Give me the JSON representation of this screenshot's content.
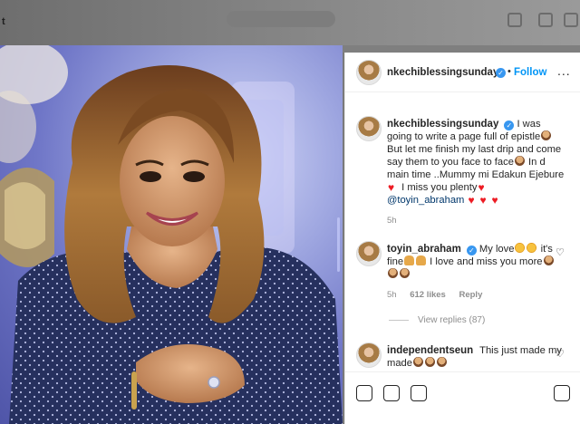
{
  "page_fragment": "t",
  "post": {
    "author": "nkechiblessingsunday",
    "follow_separator": "•",
    "follow_label": "Follow",
    "more_label": "...",
    "caption_part1": "I was going to write a page full of epistle",
    "caption_part2": " But let me finish my last drip and come say them to you face to face",
    "caption_part3": " In d main time ..Mummy mi Edakun Ejebure",
    "caption_part4": " I miss you plenty",
    "caption_mention": "@toyin_abraham",
    "caption_time": "5h"
  },
  "comments": [
    {
      "user": "toyin_abraham",
      "text_part1": " My love",
      "text_part2": " it's fine",
      "text_part3": " I love and miss you more",
      "time": "5h",
      "likes": "612 likes",
      "reply_label": "Reply"
    },
    {
      "user": "independentseun",
      "text": "This just made my made"
    }
  ],
  "view_replies_label": "View replies (87)",
  "colors": {
    "accent": "#0095f6",
    "verified": "#3897f0",
    "heart": "#ed1c24"
  },
  "icons": [
    "verified-badge-icon",
    "more-options-icon",
    "heart-icon",
    "heart-emoji",
    "woman-emoji",
    "pray-emoji",
    "heart-eyes-emoji"
  ]
}
